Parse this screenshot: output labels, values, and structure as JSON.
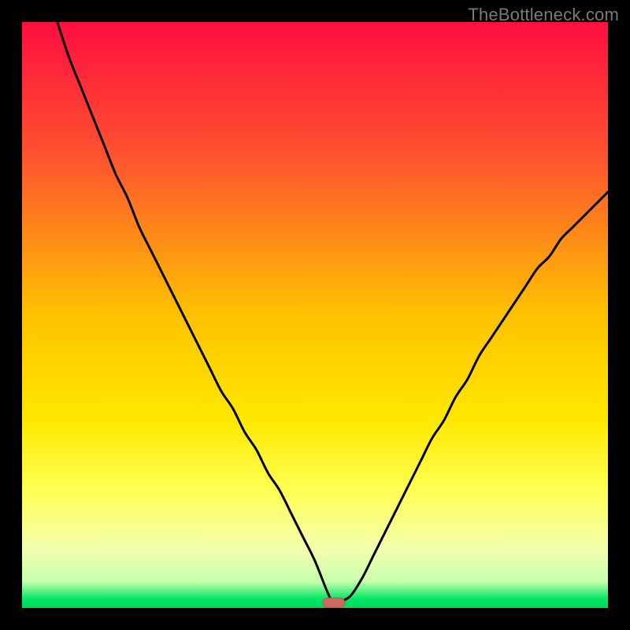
{
  "watermark": "TheBottleneck.com",
  "colors": {
    "frame": "#000000",
    "gradient_top": "#fe0e3f",
    "gradient_mid_upper": "#ff6b2e",
    "gradient_mid": "#ffd400",
    "gradient_mid_lower": "#ffff4a",
    "gradient_pale": "#f6ffb8",
    "gradient_green": "#00e765",
    "curve": "#000000",
    "marker_fill": "#cb6a62",
    "marker_stroke": "#b85a52"
  },
  "chart_data": {
    "type": "line",
    "title": "",
    "xlabel": "",
    "ylabel": "",
    "xlim": [
      0,
      100
    ],
    "ylim": [
      0,
      100
    ],
    "series": [
      {
        "name": "bottleneck-curve",
        "x": [
          6,
          8,
          10,
          12,
          14,
          16,
          18,
          20,
          22,
          24,
          26,
          28,
          30,
          32,
          34,
          36,
          38,
          40,
          42,
          44,
          46,
          48,
          50,
          52,
          53,
          54,
          56,
          58,
          60,
          62,
          64,
          66,
          68,
          70,
          72,
          74,
          76,
          78,
          80,
          82,
          84,
          86,
          88,
          90,
          92,
          94,
          96,
          98,
          100
        ],
        "y": [
          100,
          94,
          89,
          84,
          79,
          74,
          70,
          65,
          61,
          57,
          53,
          49,
          45,
          41,
          37,
          34,
          30,
          27,
          23,
          20,
          16,
          12,
          8,
          3,
          1,
          1,
          2,
          5,
          9,
          13,
          17,
          21,
          25,
          29,
          32,
          36,
          39,
          43,
          46,
          49,
          52,
          55,
          58,
          60,
          63,
          65,
          67,
          69,
          71
        ]
      }
    ],
    "annotations": [
      {
        "name": "optimal-marker",
        "x": 53.2,
        "y": 0.9,
        "shape": "rounded-pill"
      }
    ],
    "gradient_stops": [
      {
        "offset": 0.0,
        "color": "#fe0e3f"
      },
      {
        "offset": 0.23,
        "color": "#ff532f"
      },
      {
        "offset": 0.5,
        "color": "#ffc200"
      },
      {
        "offset": 0.68,
        "color": "#ffe800"
      },
      {
        "offset": 0.8,
        "color": "#ffff54"
      },
      {
        "offset": 0.9,
        "color": "#f3ffb0"
      },
      {
        "offset": 0.955,
        "color": "#c7ffab"
      },
      {
        "offset": 0.985,
        "color": "#00e765"
      },
      {
        "offset": 1.0,
        "color": "#00d85e"
      }
    ]
  }
}
